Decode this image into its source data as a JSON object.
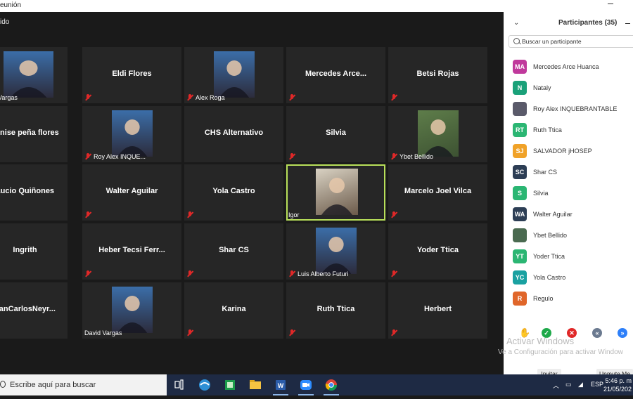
{
  "window": {
    "title": "eunión"
  },
  "meeting": {
    "top_label": "ido",
    "tiles": [
      {
        "name": "avid Vargas",
        "label": "small",
        "mic_muted": false,
        "photo": "avatar-photo-icon"
      },
      {
        "name": "Eldi Flores",
        "label": "big",
        "mic_muted": true
      },
      {
        "name": "Alex Roga",
        "label": "small",
        "mic_muted": true,
        "photo": "avatar-photo-icon"
      },
      {
        "name": "Mercedes  Arce...",
        "label": "big",
        "mic_muted": true
      },
      {
        "name": "Betsi Rojas",
        "label": "big",
        "mic_muted": true
      },
      {
        "name": "denise peña flores",
        "label": "big",
        "mic_muted": false
      },
      {
        "name": "Roy Alex INQUE...",
        "label": "small",
        "mic_muted": true,
        "photo": "avatar-photo-icon"
      },
      {
        "name": "CHS Alternativo",
        "label": "big",
        "mic_muted": false
      },
      {
        "name": "Silvia",
        "label": "big",
        "mic_muted": true
      },
      {
        "name": "Ybet Bellido",
        "label": "small",
        "mic_muted": true,
        "photo": "bird-photo-icon"
      },
      {
        "name": "Lucio Quiñones",
        "label": "big",
        "mic_muted": false
      },
      {
        "name": "Walter Aguilar",
        "label": "big",
        "mic_muted": true
      },
      {
        "name": "Yola Castro",
        "label": "big",
        "mic_muted": true
      },
      {
        "name": "Igor",
        "label": "small",
        "mic_muted": false,
        "photo": "video-feed-icon",
        "active": true
      },
      {
        "name": "Marcelo Joel Vilca",
        "label": "big",
        "mic_muted": true
      },
      {
        "name": "Ingrith",
        "label": "big",
        "mic_muted": false
      },
      {
        "name": "Heber  Tecsi  Ferr...",
        "label": "big",
        "mic_muted": true
      },
      {
        "name": "Shar CS",
        "label": "big",
        "mic_muted": true
      },
      {
        "name": "Luis Alberto Futuri",
        "label": "small",
        "mic_muted": true,
        "photo": "avatar-photo-icon"
      },
      {
        "name": "Yoder Ttica",
        "label": "big",
        "mic_muted": true
      },
      {
        "name": "uanCarlosNeyr...",
        "label": "big",
        "mic_muted": false
      },
      {
        "name": "David Vargas",
        "label": "small",
        "mic_muted": false,
        "photo": "avatar-photo-icon"
      },
      {
        "name": "Karina",
        "label": "big",
        "mic_muted": true
      },
      {
        "name": "Ruth Ttica",
        "label": "big",
        "mic_muted": true
      },
      {
        "name": "Herbert",
        "label": "big",
        "mic_muted": true
      }
    ]
  },
  "participants": {
    "title": "Participantes (35)",
    "search_placeholder": "Buscar un participante",
    "list": [
      {
        "initials": "MA",
        "name": "Mercedes Arce Huanca",
        "color": "#c0399c"
      },
      {
        "initials": "N",
        "name": "Nataly",
        "color": "#1aa179"
      },
      {
        "initials": "",
        "name": "Roy Alex INQUEBRANTABLE",
        "color": "#5a5a6a",
        "photo": true
      },
      {
        "initials": "RT",
        "name": "Ruth Ttica",
        "color": "#2bb673"
      },
      {
        "initials": "SJ",
        "name": "SALVADOR jHOSEP",
        "color": "#f0a228"
      },
      {
        "initials": "SC",
        "name": "Shar CS",
        "color": "#2d3e55"
      },
      {
        "initials": "S",
        "name": "Silvia",
        "color": "#2bb673"
      },
      {
        "initials": "WA",
        "name": "Walter Aguilar",
        "color": "#2d3e55"
      },
      {
        "initials": "",
        "name": "Ybet Bellido",
        "color": "#4a6a50",
        "photo": true
      },
      {
        "initials": "YT",
        "name": "Yoder Ttica",
        "color": "#2bb673"
      },
      {
        "initials": "YC",
        "name": "Yola Castro",
        "color": "#1aa1a1"
      },
      {
        "initials": "R",
        "name": "Regulo",
        "color": "#e0662a"
      }
    ],
    "invite_label": "Invitar",
    "unmute_label": "Unmute Me",
    "watermark_line1": "Activar Windows",
    "watermark_line2": "Ve a Configuración para activar Window"
  },
  "taskbar": {
    "search_text": "Escribe aquí para buscar",
    "tray_lang": "ESP",
    "time": "5:46 p. m",
    "date": "21/05/202"
  },
  "colors": {
    "active_speaker": "#b8e05a",
    "muted": "#e02828"
  }
}
